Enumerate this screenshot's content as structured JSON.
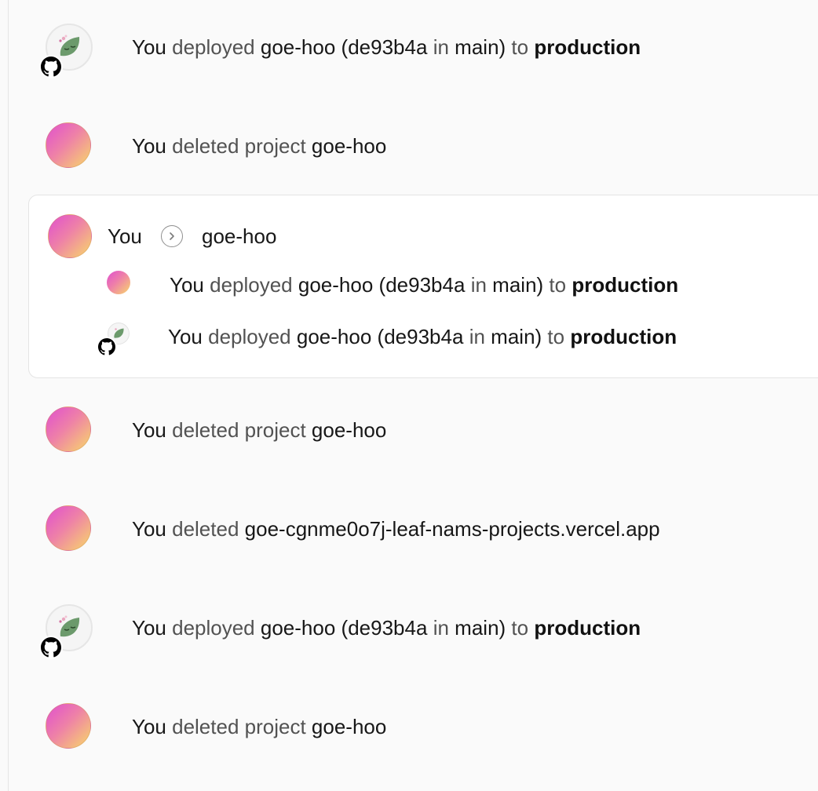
{
  "activity": {
    "row1": {
      "you": "You",
      "verb": "deployed",
      "project": "goe-hoo",
      "open": "(",
      "commit": "de93b4a",
      "in": "in",
      "branch": "main)",
      "to": "to",
      "env": "production",
      "avatar_icon": "leaf-avatar",
      "badge_icon": "github-icon"
    },
    "row2": {
      "you": "You",
      "verb": "deleted project",
      "project": "goe-hoo"
    },
    "group": {
      "header_you": "You",
      "header_project": "goe-hoo",
      "chevron_icon": "chevron-right-circle-icon",
      "sub1": {
        "you": "You",
        "verb": "deployed",
        "project": "goe-hoo",
        "open": "(",
        "commit": "de93b4a",
        "in": "in",
        "branch": "main)",
        "to": "to",
        "env": "production"
      },
      "sub2": {
        "you": "You",
        "verb": "deployed",
        "project": "goe-hoo",
        "open": "(",
        "commit": "de93b4a",
        "in": "in",
        "branch": "main)",
        "to": "to",
        "env": "production"
      }
    },
    "row4": {
      "you": "You",
      "verb": "deleted project",
      "project": "goe-hoo"
    },
    "row5": {
      "you": "You",
      "verb": "deleted",
      "domain": "goe-cgnme0o7j-leaf-nams-projects.vercel.app"
    },
    "row6": {
      "you": "You",
      "verb": "deployed",
      "project": "goe-hoo",
      "open": "(",
      "commit": "de93b4a",
      "in": "in",
      "branch": "main)",
      "to": "to",
      "env": "production"
    },
    "row7": {
      "you": "You",
      "verb": "deleted project",
      "project": "goe-hoo"
    }
  },
  "colors": {
    "gradient_start": "#e04fd0",
    "gradient_end": "#f8d86a",
    "muted_text": "#525252",
    "background": "#fafafa"
  }
}
